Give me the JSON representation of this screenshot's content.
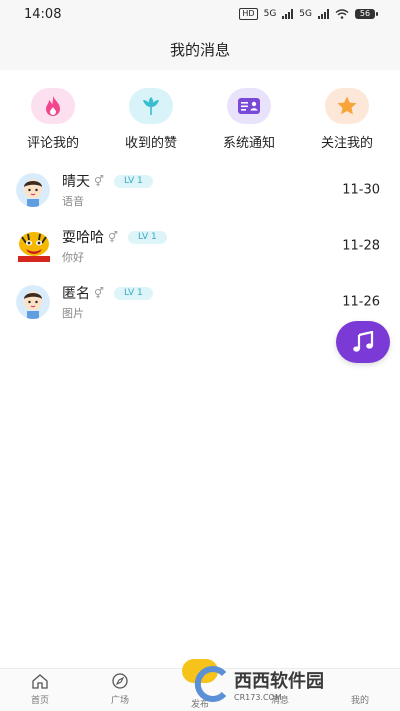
{
  "status_bar": {
    "time": "14:08",
    "hd": "HD",
    "net1": "5G",
    "net2": "5G",
    "battery": "56"
  },
  "header": {
    "title": "我的消息"
  },
  "categories": [
    {
      "label": "评论我的",
      "icon": "flame-icon",
      "bg": "#fde0ef",
      "color": "#f0478f"
    },
    {
      "label": "收到的赞",
      "icon": "flower-icon",
      "bg": "#d9f4f8",
      "color": "#3bbcd0"
    },
    {
      "label": "系统通知",
      "icon": "id-card-icon",
      "bg": "#e8e2fb",
      "color": "#7b49d8"
    },
    {
      "label": "关注我的",
      "icon": "star-icon",
      "bg": "#fde7d8",
      "color": "#f7a439"
    }
  ],
  "messages": [
    {
      "name": "晴天",
      "gender": "⚥",
      "level": "LV 1",
      "preview": "语音",
      "time": "11-30",
      "avatar": "boy-avatar"
    },
    {
      "name": "耍哈哈",
      "gender": "⚥",
      "level": "LV 1",
      "preview": "你好",
      "time": "11-28",
      "avatar": "tiger-avatar"
    },
    {
      "name": "匿名",
      "gender": "⚥",
      "level": "LV 1",
      "preview": "图片",
      "time": "11-26",
      "avatar": "boy-avatar"
    }
  ],
  "tabbar": [
    {
      "label": "首页",
      "icon": "home-icon"
    },
    {
      "label": "广场",
      "icon": "compass-icon"
    },
    {
      "label": "发布",
      "icon": "publish-icon"
    },
    {
      "label": "消息",
      "icon": "message-icon"
    },
    {
      "label": "我的",
      "icon": "profile-icon"
    }
  ],
  "watermark": {
    "text": "西西软件园",
    "sub": "CR173.COM"
  },
  "colors": {
    "accent_purple": "#7b39d6",
    "level_bg": "#ddf4f8",
    "level_text": "#39a7c6"
  }
}
